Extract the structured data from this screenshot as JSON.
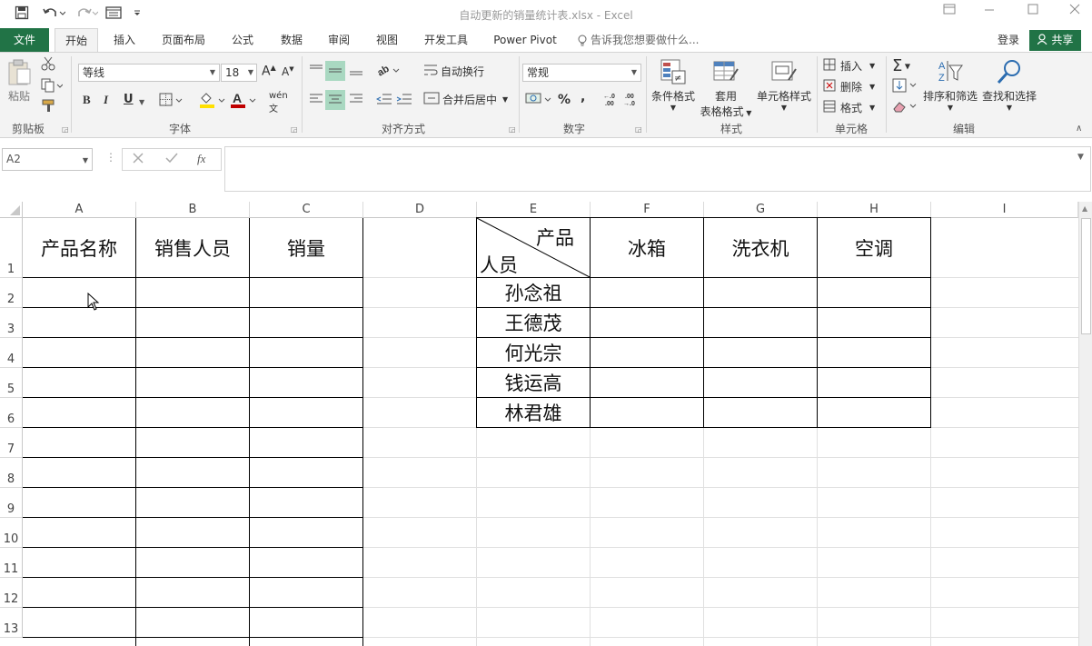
{
  "window": {
    "title": "自动更新的销量统计表.xlsx - Excel"
  },
  "tabs": {
    "file": "文件",
    "home": "开始",
    "insert": "插入",
    "page_layout": "页面布局",
    "formulas": "公式",
    "data": "数据",
    "review": "审阅",
    "view": "视图",
    "developer": "开发工具",
    "power_pivot": "Power Pivot",
    "tell_me": "告诉我您想要做什么...",
    "login": "登录",
    "share": "共享"
  },
  "ribbon": {
    "clipboard": {
      "paste": "粘贴",
      "label": "剪贴板"
    },
    "font": {
      "family": "等线",
      "size": "18",
      "bold": "B",
      "italic": "I",
      "underline": "U",
      "label": "字体"
    },
    "alignment": {
      "wrap_text": "自动换行",
      "merge_center": "合并后居中",
      "label": "对齐方式"
    },
    "number": {
      "format": "常规",
      "percent": "%",
      "comma": ",",
      "label": "数字"
    },
    "styles": {
      "conditional": "条件格式",
      "table_line1": "套用",
      "table_line2": "表格格式",
      "cell_styles": "单元格样式",
      "label": "样式"
    },
    "cells": {
      "insert": "插入",
      "delete": "删除",
      "format": "格式",
      "label": "单元格"
    },
    "editing": {
      "sort_filter": "排序和筛选",
      "find_select": "查找和选择",
      "label": "编辑"
    }
  },
  "formula_bar": {
    "name_box": "A2",
    "fx": "fx",
    "content": ""
  },
  "sheet": {
    "columns": [
      "A",
      "B",
      "C",
      "D",
      "E",
      "F",
      "G",
      "H",
      "I"
    ],
    "rows": [
      "1",
      "2",
      "3",
      "4",
      "5",
      "6",
      "7",
      "8",
      "9",
      "10",
      "11",
      "12",
      "13"
    ],
    "left_table_headers": [
      "产品名称",
      "销售人员",
      "销量"
    ],
    "diag_top": "产品",
    "diag_bottom": "人员",
    "right_table_headers": [
      "冰箱",
      "洗衣机",
      "空调"
    ],
    "salespeople": [
      "孙念祖",
      "王德茂",
      "何光宗",
      "钱运高",
      "林君雄"
    ]
  },
  "colors": {
    "excel_green": "#217346",
    "accent_select": "#a9d8c1"
  }
}
